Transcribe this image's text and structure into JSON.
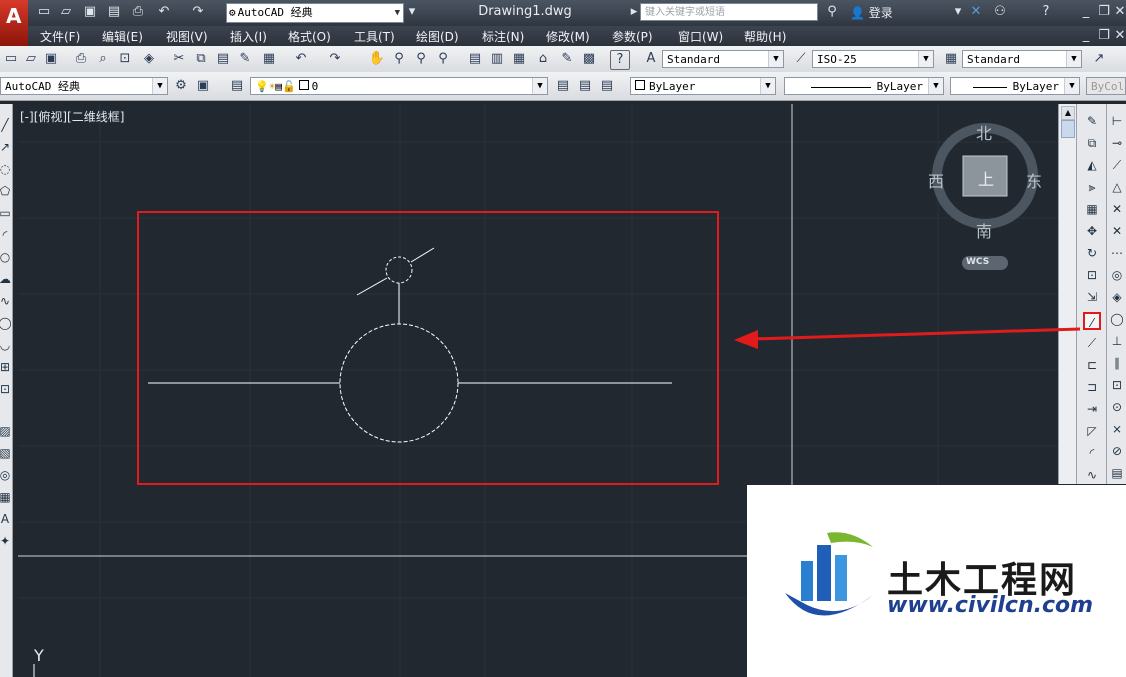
{
  "titlebar": {
    "workspace": "AutoCAD 经典",
    "document_title": "Drawing1.dwg",
    "search_placeholder": "键入关键字或短语",
    "login_label": "登录"
  },
  "menu": {
    "items": [
      "文件(F)",
      "编辑(E)",
      "视图(V)",
      "插入(I)",
      "格式(O)",
      "工具(T)",
      "绘图(D)",
      "标注(N)",
      "修改(M)",
      "参数(P)",
      "窗口(W)",
      "帮助(H)"
    ]
  },
  "styles_toolbar": {
    "text_style": "Standard",
    "dim_style": "ISO-25",
    "table_style": "Standard"
  },
  "layers_toolbar": {
    "workspace": "AutoCAD 经典",
    "current_layer": "0",
    "color": "ByLayer",
    "linetype": "ByLayer",
    "lineweight": "ByLayer",
    "plotstyle": "ByColor"
  },
  "viewport": {
    "label": "[-][俯视][二维线框]",
    "axis_y": "Y"
  },
  "viewcube": {
    "north": "北",
    "south": "南",
    "east": "东",
    "west": "西",
    "top": "上",
    "wcs": "WCS"
  },
  "watermark": {
    "title": "土木工程网",
    "url": "www.civilcn.com"
  },
  "colors": {
    "canvas": "#212830",
    "highlight": "#e11b1b",
    "drawing_line": "#ffffff"
  }
}
